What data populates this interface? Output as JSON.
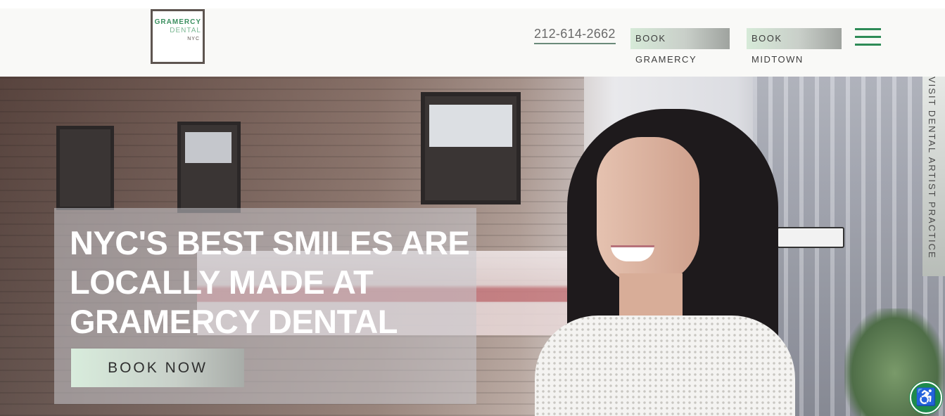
{
  "header": {
    "logo": {
      "line1": "GRAMERCY",
      "line2": "DENTAL",
      "line3": "NYC"
    },
    "phone": "212-614-2662",
    "book_gramercy": "BOOK GRAMERCY",
    "book_midtown": "BOOK MIDTOWN",
    "menu_icon": "hamburger-menu-icon"
  },
  "hero": {
    "title": "NYC'S BEST SMILES ARE LOCALLY MADE AT GRAMERCY DENTAL",
    "cta": "BOOK NOW"
  },
  "side_tab": {
    "label": "VISIT DENTAL ARTIST PRACTICE"
  },
  "accessibility": {
    "icon": "accessibility-icon",
    "glyph": "♿"
  },
  "colors": {
    "brand_green": "#2e8b57",
    "logo_border": "#5e5550",
    "accessibility_bg": "#1e8a4c"
  }
}
